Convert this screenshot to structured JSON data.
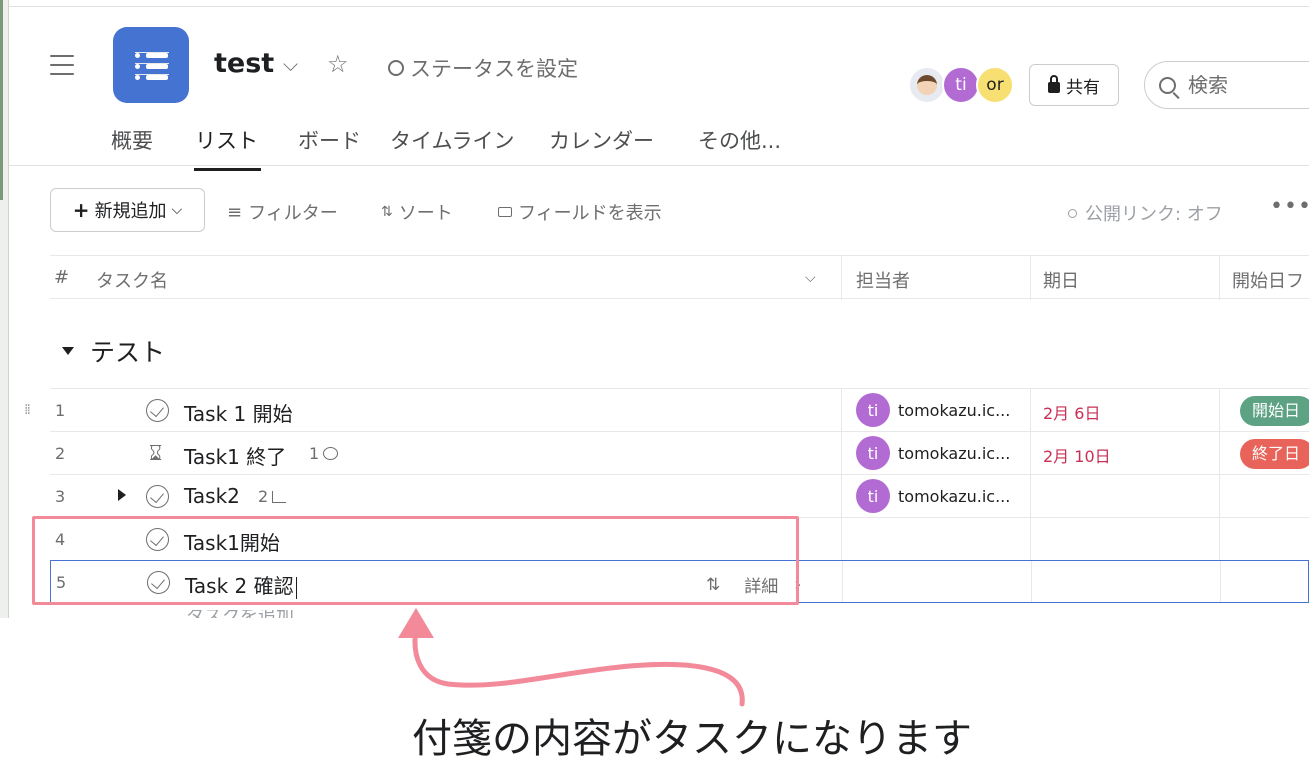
{
  "header": {
    "project_title": "test",
    "status_label": "ステータスを設定",
    "avatars": [
      "ti",
      "or"
    ],
    "share_label": "共有",
    "search_placeholder": "検索"
  },
  "tabs": [
    "概要",
    "リスト",
    "ボード",
    "タイムライン",
    "カレンダー",
    "その他..."
  ],
  "active_tab": "リスト",
  "toolbar": {
    "new_label": "新規追加",
    "filter_label": "フィルター",
    "sort_label": "ソート",
    "fields_label": "フィールドを表示",
    "public_link_label": "公開リンク: オフ",
    "more_label": "•••"
  },
  "columns": {
    "hash": "#",
    "task_name": "タスク名",
    "assignee": "担当者",
    "due_date": "期日",
    "start_field": "開始日フ"
  },
  "section": {
    "name": "テスト"
  },
  "tasks": [
    {
      "num": "1",
      "name": "Task 1 開始",
      "meta": "",
      "assignee_initials": "ti",
      "assignee": "tomokazu.ic...",
      "due": "2月 6日",
      "tag": "開始日",
      "tag_color": "#5da283"
    },
    {
      "num": "2",
      "name": "Task1 終了",
      "meta": "1",
      "assignee_initials": "ti",
      "assignee": "tomokazu.ic...",
      "due": "2月 10日",
      "tag": "終了日",
      "tag_color": "#e8645a"
    },
    {
      "num": "3",
      "name": "Task2",
      "meta": "2",
      "assignee_initials": "ti",
      "assignee": "tomokazu.ic...",
      "due": "",
      "tag": "",
      "tag_color": ""
    },
    {
      "num": "4",
      "name": "Task1開始",
      "meta": "",
      "assignee_initials": "",
      "assignee": "",
      "due": "",
      "tag": "",
      "tag_color": ""
    },
    {
      "num": "5",
      "name": "Task 2 確認",
      "meta": "",
      "assignee_initials": "",
      "assignee": "",
      "due": "",
      "tag": "",
      "tag_color": ""
    }
  ],
  "row_actions": {
    "detail_label": "詳細"
  },
  "cut_row_text": "タスクを追加...",
  "caption": "付箋の内容がタスクになります",
  "colors": {
    "accent": "#4573d2",
    "highlight": "#f28a99",
    "due_red": "#c92f54"
  }
}
